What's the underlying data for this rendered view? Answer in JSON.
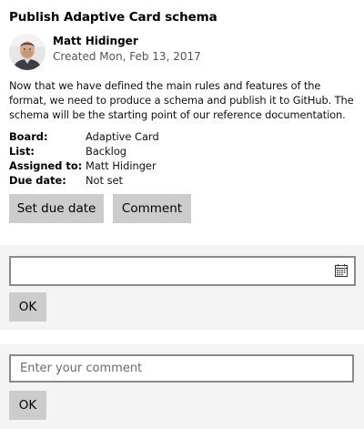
{
  "card": {
    "title": "Publish Adaptive Card schema",
    "author": {
      "name": "Matt Hidinger",
      "created": "Created Mon, Feb 13, 2017"
    },
    "description": "Now that we have defined the main rules and features of the format, we need to produce a schema and publish it to GitHub. The schema will be the starting point of our reference documentation.",
    "facts": [
      {
        "label": "Board:",
        "value": "Adaptive Card"
      },
      {
        "label": "List:",
        "value": "Backlog"
      },
      {
        "label": "Assigned to:",
        "value": "Matt Hidinger"
      },
      {
        "label": "Due date:",
        "value": "Not set"
      }
    ],
    "actions": {
      "set_due_date": "Set due date",
      "comment": "Comment"
    }
  },
  "due_date_panel": {
    "date_value": "",
    "ok_label": "OK",
    "icon": "calendar-icon"
  },
  "comment_panel": {
    "placeholder": "Enter your comment",
    "value": "",
    "ok_label": "OK"
  },
  "colors": {
    "button_bg": "#cccccc",
    "panel_bg": "#f4f4f4",
    "input_border": "#8a8a8a",
    "secondary_text": "#555555"
  }
}
